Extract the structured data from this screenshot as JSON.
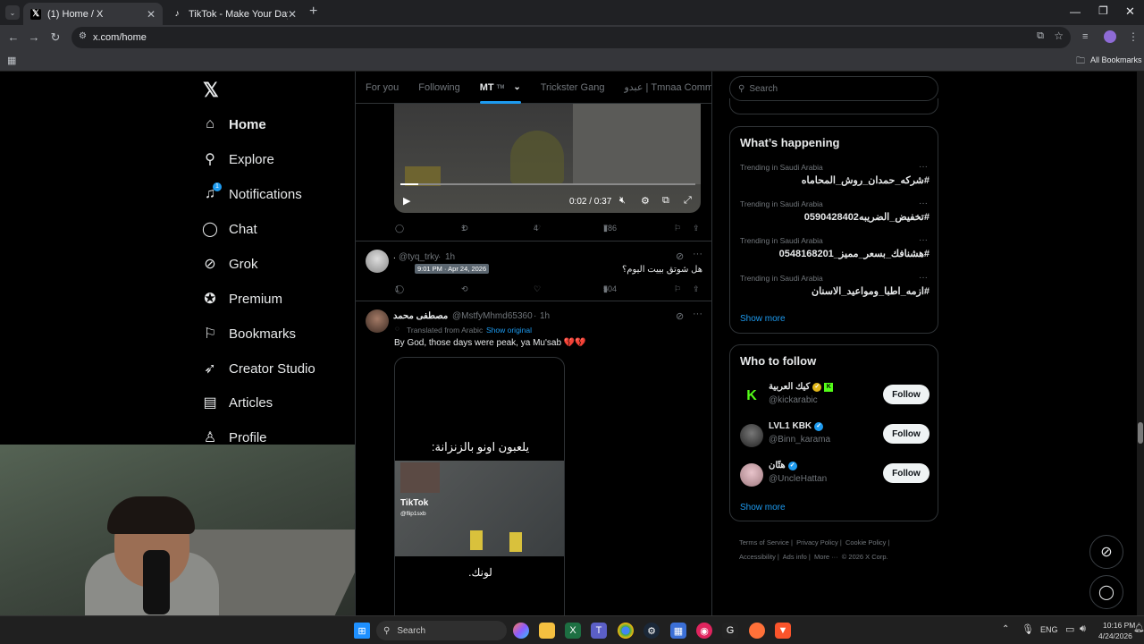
{
  "browser": {
    "tabs": [
      {
        "title": "(1) Home / X",
        "active": true
      },
      {
        "title": "TikTok - Make Your Day",
        "active": false
      }
    ],
    "url": "x.com/home",
    "all_bookmarks": "All Bookmarks"
  },
  "leftnav": {
    "items": [
      {
        "label": "Home",
        "icon": "home-icon"
      },
      {
        "label": "Explore",
        "icon": "search-icon"
      },
      {
        "label": "Notifications",
        "icon": "bell-icon",
        "badge": "1"
      },
      {
        "label": "Chat",
        "icon": "chat-icon"
      },
      {
        "label": "Grok",
        "icon": "grok-icon"
      },
      {
        "label": "Premium",
        "icon": "premium-icon"
      },
      {
        "label": "Bookmarks",
        "icon": "bookmark-icon"
      },
      {
        "label": "Creator Studio",
        "icon": "rocket-icon"
      },
      {
        "label": "Articles",
        "icon": "article-icon"
      },
      {
        "label": "Profile",
        "icon": "person-icon"
      }
    ]
  },
  "feed": {
    "tabs": [
      "For you",
      "Following",
      "MT",
      "Trickster Gang",
      "عبدو | Tmnaa Community"
    ],
    "tab_tm": "TM",
    "video": {
      "time": "0:02 / 0:37"
    },
    "post1_actions": {
      "reposts": "1",
      "likes": "4",
      "views": "786"
    },
    "post2": {
      "handle": "@tyq_trky",
      "time": "1h",
      "tooltip": "9:01 PM · Apr 24, 2026",
      "text": "هل شوتق بييت اليوم؟",
      "replies": "1",
      "views": "504"
    },
    "post3": {
      "name": "مصطفى محمد",
      "handle": "@MstfyMhmd65360",
      "time": "1h",
      "translated": "Translated from Arabic",
      "show_original": "Show original",
      "text": "By God, those days were peak, ya Mu'sab 💔💔",
      "media_caption_top": "يلعبون اونو بالزنزانة:",
      "media_tiktok": "TikTok",
      "media_tiktok_handle": "@flip1sxb",
      "media_caption_bottom": "لونك."
    }
  },
  "right": {
    "search_placeholder": "Search",
    "happening_title": "What’s happening",
    "trends": [
      {
        "meta": "Trending in Saudi Arabia",
        "tag": "#شركه_حمدان_روش_المحاماه"
      },
      {
        "meta": "Trending in Saudi Arabia",
        "tag": "#تخفيض_الضريبه0590428402"
      },
      {
        "meta": "Trending in Saudi Arabia",
        "tag": "#هشنافك_بسعر_مميز_0548168201"
      },
      {
        "meta": "Trending in Saudi Arabia",
        "tag": "#ازمه_اطبا_ومواعيد_الاسنان"
      }
    ],
    "show_more": "Show more",
    "wtf_title": "Who to follow",
    "wtf": [
      {
        "name": "كيك العربية",
        "handle": "@kickarabic",
        "follow": "Follow",
        "color": "#53fc18"
      },
      {
        "name": "LVL1 KBK",
        "handle": "@Binn_karama",
        "follow": "Follow",
        "color": "#555"
      },
      {
        "name": "هتّان",
        "handle": "@UncleHattan",
        "follow": "Follow",
        "color": "#c9a0a8"
      }
    ],
    "show_more2": "Show more",
    "footer": [
      "Terms of Service",
      "Privacy Policy",
      "Cookie Policy",
      "Accessibility",
      "Ads info",
      "More ···",
      "© 2026 X Corp."
    ]
  },
  "taskbar": {
    "search": "Search",
    "lang": "ENG",
    "time": "10:16 PM",
    "date": "4/24/2026"
  }
}
